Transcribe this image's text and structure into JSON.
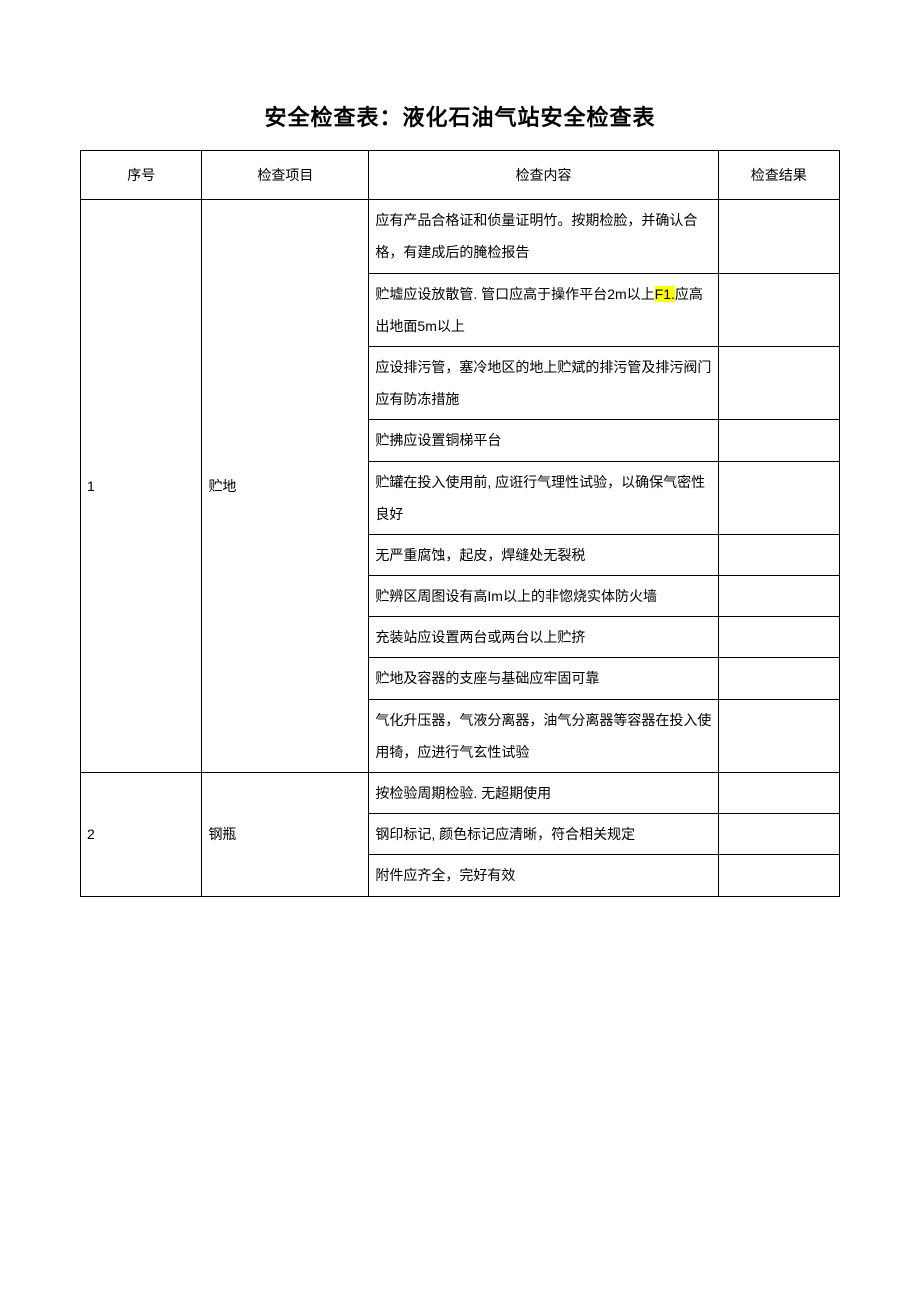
{
  "title": "安全检查表：液化石油气站安全检查表",
  "headers": {
    "seq": "序号",
    "item": "检查项目",
    "content": "检查内容",
    "result": "检查结果"
  },
  "rows": [
    {
      "seq": "1",
      "item": "贮地",
      "contents": [
        "应有产品合格证和侦量证明竹。按期检脸，并确认合格，有建成后的腌检报告",
        "__SPECIAL_ROW_2__",
        "应设排污管，塞冷地区的地上贮斌的排污管及排污阀门应有防冻措施",
        "贮拂应设置铜梯平台",
        "贮罐在投入使用前, 应诳行气理性试验，以确保气密性良好",
        "无严重腐蚀，起皮，焊缝处无裂税",
        "__SPECIAL_ROW_7__",
        "充装站应设置两台或两台以上贮挤",
        "贮地及容器的支座与基础应牢固可靠",
        "气化升压器，气液分离器，油气分离器等容器在投入使用犄，应进行气玄性试验"
      ]
    },
    {
      "seq": "2",
      "item": "钢瓶",
      "contents": [
        "按检验周期检验. 无超期使用",
        "钢印标记, 颜色标记应清晰，符合相关规定",
        "附件应齐全，完好有效"
      ]
    }
  ],
  "special": {
    "row2_a": "贮墟应设放散管. 管口应高于操作平台",
    "row2_b": "2m",
    "row2_c": "以上",
    "row2_d": "F1.",
    "row2_e": "应高出地面",
    "row2_f": "5m",
    "row2_g": "以上",
    "row7_a": "贮辨区周图设有高",
    "row7_b": "Im",
    "row7_c": "以上的非惚烧实体防火墙"
  }
}
